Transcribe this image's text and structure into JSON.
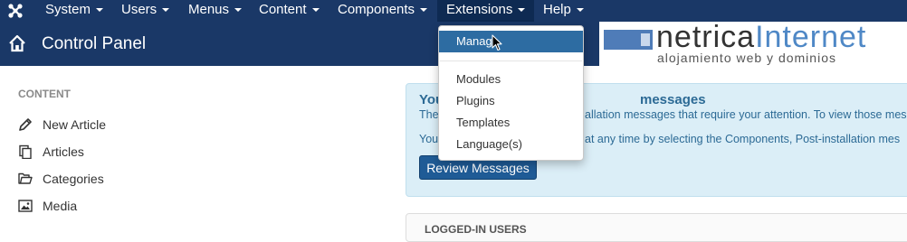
{
  "navbar": {
    "logo_icon": "joomla-logo-icon",
    "menus": [
      "System",
      "Users",
      "Menus",
      "Content",
      "Components",
      "Extensions",
      "Help"
    ],
    "active_menu": "Extensions"
  },
  "subhead": {
    "icon": "home-icon",
    "title": "Control Panel"
  },
  "brand": {
    "word_part1": "netrica",
    "word_part2": "Internet",
    "tagline": "alojamiento web y dominios",
    "colors": {
      "box": "#4f7cb8",
      "accent": "#4f88c6"
    }
  },
  "sidebar": {
    "heading": "CONTENT",
    "items": [
      {
        "label": "New Article",
        "icon": "pencil-icon"
      },
      {
        "label": "Articles",
        "icon": "copy-icon"
      },
      {
        "label": "Categories",
        "icon": "folder-icon"
      },
      {
        "label": "Media",
        "icon": "image-icon"
      }
    ]
  },
  "message_panel": {
    "title_start": "You",
    "title_end": "messages",
    "line1_start": "The",
    "line1_end": "allation messages that require your attention. To view those mes",
    "line2_start": "You",
    "line2_end": "at any time by selecting the Components, Post-installation mes",
    "button_label": "Review Messages"
  },
  "logged_panel": {
    "title": "LOGGED-IN USERS"
  },
  "dropdown": {
    "items": [
      "Manage",
      "Modules",
      "Plugins",
      "Templates",
      "Language(s)"
    ],
    "active_item": "Manage"
  },
  "colors": {
    "navbar": "#1a3867",
    "dropdown_active": "#2d6ca2",
    "button": "#1f5b96",
    "info_bg": "#dbeef7",
    "info_text": "#2c6a95"
  }
}
